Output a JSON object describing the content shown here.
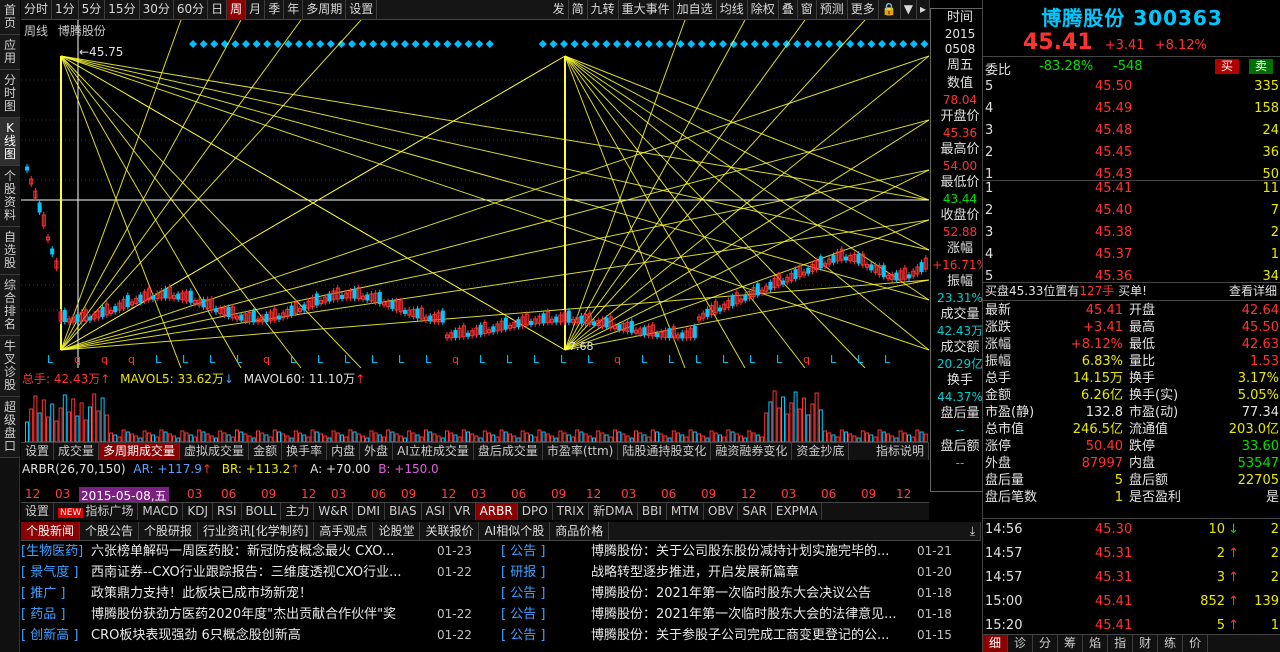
{
  "left_nav": [
    {
      "label": "首页"
    },
    {
      "label": "应用"
    },
    {
      "label": "分时图"
    },
    {
      "label": "K线图"
    },
    {
      "label": "个股资料"
    },
    {
      "label": "自选股"
    },
    {
      "label": "综合排名"
    },
    {
      "label": "牛叉诊股"
    },
    {
      "label": "超级盘口"
    }
  ],
  "top_bar": {
    "periods": [
      "分时",
      "1分",
      "5分",
      "15分",
      "30分",
      "60分",
      "日",
      "周",
      "月",
      "季",
      "年",
      "多周期",
      "设置"
    ],
    "active_period": "周",
    "right_buttons": [
      "发",
      "简",
      "九转",
      "重大事件",
      "加自选",
      "均线",
      "除权",
      "叠",
      "窗",
      "预测",
      "更多"
    ]
  },
  "chart": {
    "label_period": "周线",
    "label_stock": "博腾股份",
    "high_marker": "45.75",
    "low_marker": "7.68",
    "colors": {
      "up": "#ff3232",
      "down": "#00c8ff",
      "fan": "#ffff33",
      "diamond": "#00bfff"
    }
  },
  "volume": {
    "total_label": "总手: 42.43万",
    "ma5_label": "MAVOL5: 33.62万",
    "ma60_label": "MAVOL60: 11.10万"
  },
  "indicator_tabs": [
    "设置",
    "成交量",
    "多周期成交量",
    "虚拟成交量",
    "金额",
    "换手率",
    "内盘",
    "外盘",
    "AI立桩成交量",
    "盘后成交量",
    "市盈率(ttm)",
    "陆股通持股变化",
    "融资融券变化",
    "资金抄底",
    "指标说明"
  ],
  "arbr": {
    "name": "ARBR(26,70,150)",
    "ar": "AR: +117.9",
    "br": "BR: +113.2",
    "a": "A: +70.00",
    "b": "B: +150.0"
  },
  "date_axis": {
    "highlight": "2015-05-08,五",
    "ticks": [
      "12",
      "03",
      "2",
      "03",
      "06",
      "09",
      "12",
      "03",
      "06",
      "09",
      "12",
      "03",
      "06",
      "09",
      "12",
      "03",
      "06",
      "09",
      "12",
      "03",
      "06",
      "09",
      "12"
    ]
  },
  "bottom_tabs": {
    "new_badge": "NEW",
    "items": [
      "设置",
      "指标广场",
      "MACD",
      "KDJ",
      "RSI",
      "BOLL",
      "主力",
      "W&R",
      "DMI",
      "BIAS",
      "ASI",
      "VR",
      "ARBR",
      "DPO",
      "TRIX",
      "新DMA",
      "BBI",
      "MTM",
      "OBV",
      "SAR",
      "EXPMA"
    ],
    "active": "ARBR"
  },
  "news_tabs": [
    "个股新闻",
    "个股公告",
    "个股研报",
    "行业资讯[化学制药]",
    "高手观点",
    "论股堂",
    "关联报价",
    "AI相似个股",
    "商品价格"
  ],
  "news": [
    {
      "tag": "[生物医药]",
      "title": "六张榜单解码一周医药股：新冠防疫概念最火 CXO...",
      "date": "01-23",
      "tag2": "[ 公告 ]",
      "title2": "博腾股份：关于公司股东股份减持计划实施完毕的...",
      "date2": "01-21"
    },
    {
      "tag": "[ 景气度 ]",
      "title": "西南证券--CXO行业跟踪报告：三维度透视CXO行业...",
      "date": "01-22",
      "tag2": "[ 研报 ]",
      "title2": "战略转型逐步推进，开启发展新篇章",
      "date2": "01-20"
    },
    {
      "tag": "[ 推广 ]",
      "title": "政策鼎力支持！此板块已成市场新宠！",
      "date": "",
      "tag2": "[ 公告 ]",
      "title2": "博腾股份：2021年第一次临时股东大会决议公告",
      "date2": "01-18"
    },
    {
      "tag": "[ 药品 ]",
      "title": "博腾股份获劲方医药2020年度\"杰出贡献合作伙伴\"奖",
      "date": "01-22",
      "tag2": "[ 公告 ]",
      "title2": "博腾股份：2021年第一次临时股东大会的法律意见...",
      "date2": "01-18"
    },
    {
      "tag": "[ 创新高 ]",
      "title": "CRO板块表现强劲 6只概念股创新高",
      "date": "01-22",
      "tag2": "[ 公告 ]",
      "title2": "博腾股份：关于参股子公司完成工商变更登记的公...",
      "date2": "01-15"
    }
  ],
  "info_panel": [
    {
      "label": "时间",
      "value": "2015",
      "value2": "0508",
      "color": "wht"
    },
    {
      "label": "周五",
      "value": "",
      "color": "wht"
    },
    {
      "label": "数值",
      "value": "78.04",
      "color": "red"
    },
    {
      "label": "开盘价",
      "value": "45.36",
      "color": "red"
    },
    {
      "label": "最高价",
      "value": "54.00",
      "color": "red"
    },
    {
      "label": "最低价",
      "value": "43.44",
      "color": "grn"
    },
    {
      "label": "收盘价",
      "value": "52.88",
      "color": "red"
    },
    {
      "label": "涨幅",
      "value": "+16.71%",
      "color": "red"
    },
    {
      "label": "振幅",
      "value": "23.31%",
      "color": "cyan"
    },
    {
      "label": "成交量",
      "value": "42.43万",
      "color": "cyan"
    },
    {
      "label": "成交额",
      "value": "20.29亿",
      "color": "cyan"
    },
    {
      "label": "换手",
      "value": "44.37%",
      "color": "cyan"
    },
    {
      "label": "盘后量",
      "value": "--",
      "color": "cyan"
    },
    {
      "label": "盘后额",
      "value": "--",
      "color": "cyan"
    }
  ],
  "quote": {
    "name": "博腾股份",
    "code": "300363",
    "price": "45.41",
    "change": "+3.41",
    "change_pct": "+8.12%",
    "ratio_label": "委比",
    "ratio": "-83.28%",
    "ratio_diff": "-548",
    "buy_btn": "买",
    "sell_btn": "卖",
    "asks": [
      {
        "level": "5",
        "price": "45.50",
        "vol": "335"
      },
      {
        "level": "4",
        "price": "45.49",
        "vol": "158"
      },
      {
        "level": "3",
        "price": "45.48",
        "vol": "24"
      },
      {
        "level": "2",
        "price": "45.45",
        "vol": "36"
      },
      {
        "level": "1",
        "price": "45.43",
        "vol": "50"
      }
    ],
    "bids": [
      {
        "level": "1",
        "price": "45.41",
        "vol": "11"
      },
      {
        "level": "2",
        "price": "45.40",
        "vol": "7"
      },
      {
        "level": "3",
        "price": "45.38",
        "vol": "2"
      },
      {
        "level": "4",
        "price": "45.37",
        "vol": "1"
      },
      {
        "level": "5",
        "price": "45.36",
        "vol": "34"
      }
    ],
    "buy_notice_a": "买盘45.33位置有",
    "buy_notice_b": "127手",
    "buy_notice_c": "买单!",
    "buy_notice_link": "查看详细",
    "stats": [
      {
        "l1": "最新",
        "v1": "45.41",
        "c1": "red",
        "l2": "开盘",
        "v2": "42.64",
        "c2": "red"
      },
      {
        "l1": "涨跌",
        "v1": "+3.41",
        "c1": "red",
        "l2": "最高",
        "v2": "45.50",
        "c2": "red"
      },
      {
        "l1": "涨幅",
        "v1": "+8.12%",
        "c1": "red",
        "l2": "最低",
        "v2": "42.63",
        "c2": "red"
      },
      {
        "l1": "振幅",
        "v1": "6.83%",
        "c1": "yel",
        "l2": "量比",
        "v2": "1.53",
        "c2": "red"
      },
      {
        "l1": "总手",
        "v1": "14.15万",
        "c1": "yel",
        "l2": "换手",
        "v2": "3.17%",
        "c2": "yel"
      },
      {
        "l1": "金额",
        "v1": "6.26亿",
        "c1": "yel",
        "l2": "换手(实)",
        "v2": "5.05%",
        "c2": "yel"
      },
      {
        "l1": "市盈(静)",
        "v1": "132.8",
        "c1": "wht",
        "l2": "市盈(动)",
        "v2": "77.34",
        "c2": "wht"
      },
      {
        "l1": "总市值",
        "v1": "246.5亿",
        "c1": "yel",
        "l2": "流通值",
        "v2": "203.0亿",
        "c2": "yel"
      },
      {
        "l1": "涨停",
        "v1": "50.40",
        "c1": "red",
        "l2": "跌停",
        "v2": "33.60",
        "c2": "grn"
      },
      {
        "l1": "外盘",
        "v1": "87997",
        "c1": "red",
        "l2": "内盘",
        "v2": "53547",
        "c2": "grn"
      },
      {
        "l1": "盘后量",
        "v1": "5",
        "c1": "yel",
        "l2": "盘后额",
        "v2": "22705",
        "c2": "yel"
      },
      {
        "l1": "盘后笔数",
        "v1": "1",
        "c1": "yel",
        "l2": "是否盈利",
        "v2": "是",
        "c2": "wht"
      }
    ],
    "ticks": [
      {
        "time": "14:56",
        "price": "45.30",
        "vol": "10",
        "dir": "↓",
        "n": "2"
      },
      {
        "time": "14:57",
        "price": "45.31",
        "vol": "2",
        "dir": "↑",
        "n": "2"
      },
      {
        "time": "14:57",
        "price": "45.31",
        "vol": "3",
        "dir": "↑",
        "n": "2"
      },
      {
        "time": "15:00",
        "price": "45.41",
        "vol": "852",
        "dir": "↑",
        "n": "139"
      },
      {
        "time": "15:20",
        "price": "45.41",
        "vol": "5",
        "dir": "↑",
        "n": "1"
      }
    ],
    "tabs": [
      "细",
      "诊",
      "分",
      "筹",
      "焰",
      "指",
      "财",
      "练",
      "价"
    ]
  }
}
